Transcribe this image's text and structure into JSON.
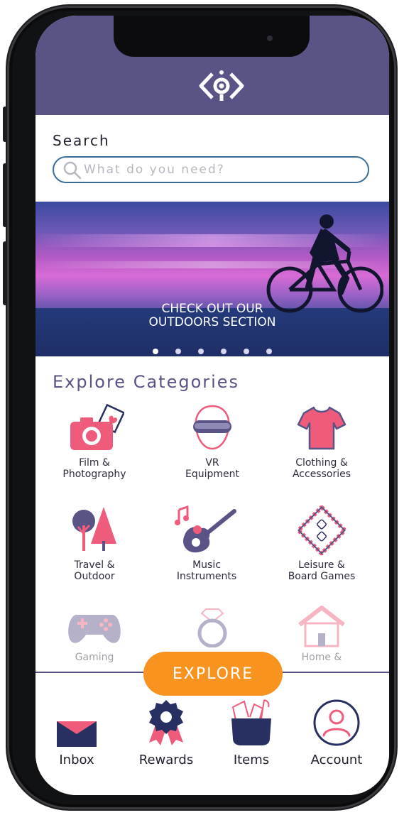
{
  "header": {
    "logo_icon": "diamond-target-logo-icon"
  },
  "search": {
    "label": "Search",
    "placeholder": "What do you need?"
  },
  "banner": {
    "cta_line1": "CHECK OUT OUR",
    "cta_line2": "OUTDOORS SECTION",
    "dots_count": 6,
    "active_dot": 0
  },
  "categories_title": "Explore Categories",
  "categories": [
    {
      "line1": "Film &",
      "line2": "Photography",
      "icon": "camera-icon"
    },
    {
      "line1": "VR",
      "line2": "Equipment",
      "icon": "vr-headset-icon"
    },
    {
      "line1": "Clothing &",
      "line2": "Accessories",
      "icon": "tshirt-icon"
    },
    {
      "line1": "Travel &",
      "line2": "Outdoor",
      "icon": "trees-icon"
    },
    {
      "line1": "Music",
      "line2": "Instruments",
      "icon": "guitar-icon"
    },
    {
      "line1": "Leisure &",
      "line2": "Board Games",
      "icon": "board-game-icon"
    },
    {
      "line1": "Gaming",
      "line2": "",
      "icon": "gamepad-icon"
    },
    {
      "line1": "",
      "line2": "",
      "icon": "ring-icon"
    },
    {
      "line1": "Home &",
      "line2": "",
      "icon": "house-icon"
    }
  ],
  "explore_button": "EXPLORE",
  "nav": [
    {
      "label": "Inbox",
      "icon": "envelope-icon"
    },
    {
      "label": "Rewards",
      "icon": "award-ribbon-icon"
    },
    {
      "label": "Items",
      "icon": "items-basket-icon"
    },
    {
      "label": "Account",
      "icon": "user-circle-icon"
    }
  ],
  "colors": {
    "primary": "#5a5486",
    "accent": "#f7931e",
    "pink": "#ef5b7b",
    "navy": "#283062"
  }
}
